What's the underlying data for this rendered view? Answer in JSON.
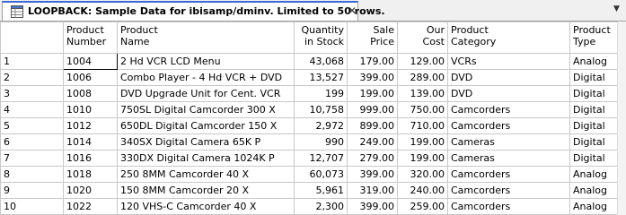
{
  "tab": {
    "title": "LOOPBACK: Sample Data for ibisamp/dminv. Limited to 50 rows.",
    "close": "✕",
    "icon": "database-grid-icon",
    "dropdown": "▼"
  },
  "table": {
    "headers": [
      {
        "line1": "",
        "line2": ""
      },
      {
        "line1": "Product",
        "line2": "Number"
      },
      {
        "line1": "Product",
        "line2": "Name"
      },
      {
        "line1": "Quantity",
        "line2": "in Stock"
      },
      {
        "line1": "Sale",
        "line2": "Price"
      },
      {
        "line1": "Our",
        "line2": "Cost"
      },
      {
        "line1": "Product",
        "line2": "Category"
      },
      {
        "line1": "Product",
        "line2": "Type"
      }
    ],
    "rows": [
      [
        "1",
        "1004",
        "2 Hd VCR LCD Menu",
        "43,068",
        "179.00",
        "129.00",
        "VCRs",
        "Analog"
      ],
      [
        "2",
        "1006",
        "Combo Player - 4 Hd VCR + DVD",
        "13,527",
        "399.00",
        "289.00",
        "DVD",
        "Digital"
      ],
      [
        "3",
        "1008",
        "DVD Upgrade Unit for Cent. VCR",
        "199",
        "199.00",
        "139.00",
        "DVD",
        "Digital"
      ],
      [
        "4",
        "1010",
        "750SL Digital Camcorder 300 X",
        "10,758",
        "999.00",
        "750.00",
        "Camcorders",
        "Digital"
      ],
      [
        "5",
        "1012",
        "650DL Digital Camcorder 150 X",
        "2,972",
        "899.00",
        "710.00",
        "Camcorders",
        "Digital"
      ],
      [
        "6",
        "1014",
        "340SX Digital Camera 65K P",
        "990",
        "249.00",
        "199.00",
        "Cameras",
        "Digital"
      ],
      [
        "7",
        "1016",
        "330DX Digital Camera 1024K P",
        "12,707",
        "279.00",
        "199.00",
        "Cameras",
        "Digital"
      ],
      [
        "8",
        "1018",
        "250 8MM Camcorder 40 X",
        "60,073",
        "399.00",
        "320.00",
        "Camcorders",
        "Analog"
      ],
      [
        "9",
        "1020",
        "150 8MM Camcorder 20 X",
        "5,961",
        "319.00",
        "240.00",
        "Camcorders",
        "Analog"
      ],
      [
        "10",
        "1022",
        "120 VHS-C Camcorder 40 X",
        "2,300",
        "399.00",
        "259.00",
        "Camcorders",
        "Analog"
      ]
    ]
  }
}
